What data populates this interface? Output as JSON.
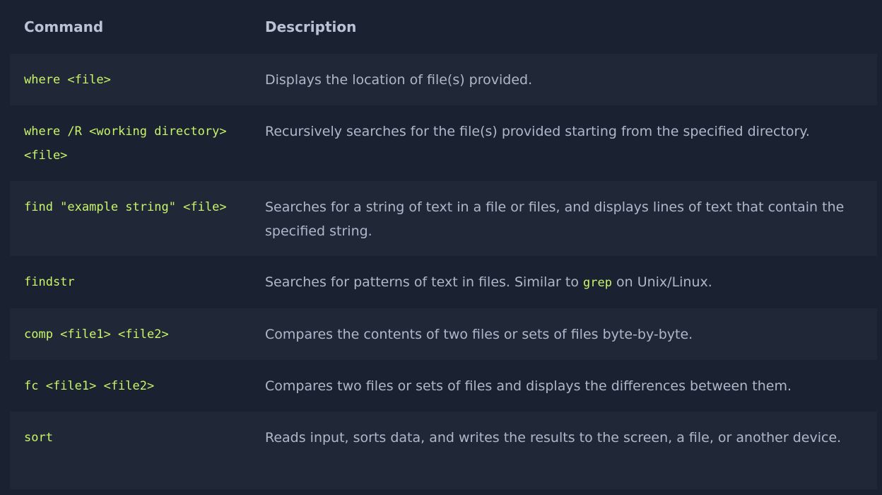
{
  "table": {
    "headers": {
      "command": "Command",
      "description": "Description"
    },
    "rows": [
      {
        "command": "where <file>",
        "description": "Displays the location of file(s) provided."
      },
      {
        "command": "where /R <working directory>\n<file>",
        "description": "Recursively searches for the file(s) provided starting from the specified directory."
      },
      {
        "command": "find \"example string\" <file>",
        "description": "Searches for a string of text in a file or files, and displays lines of text that contain the specified string."
      },
      {
        "command": "findstr",
        "description_before": "Searches for patterns of text in files. Similar to ",
        "description_code": "grep",
        "description_after": " on Unix/Linux."
      },
      {
        "command": "comp <file1> <file2>",
        "description": "Compares the contents of two files or sets of files byte-by-byte."
      },
      {
        "command": "fc <file1> <file2>",
        "description": "Compares two files or sets of files and displays the differences between them."
      },
      {
        "command": "sort",
        "description": "Reads input, sorts data, and writes the results to the screen, a file, or another device."
      }
    ]
  },
  "colors": {
    "page_bg": "#1a2130",
    "row_shaded_bg": "#202837",
    "code_text": "#c8f56a",
    "desc_text": "#aeb8c8",
    "header_text": "#b9c3d3"
  }
}
